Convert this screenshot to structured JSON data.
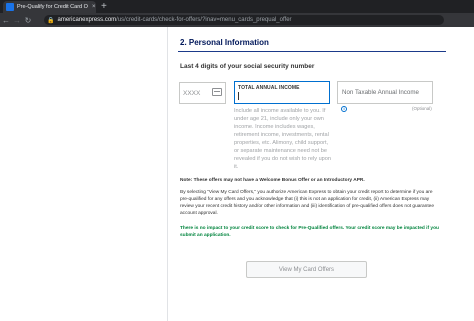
{
  "browser": {
    "tab_title": "Pre-Qualify for Credit Card O",
    "tab_close": "×",
    "new_tab": "+",
    "back": "←",
    "forward": "→",
    "reload": "↻",
    "url_host": "americanexpress.com",
    "url_path": "/us/credit-cards/check-for-offers/?inav=menu_cards_prequal_offer"
  },
  "form": {
    "section_title": "2. Personal Information",
    "ssn_label": "Last 4 digits of your social security number",
    "ssn_placeholder": "XXXX",
    "income_label": "TOTAL ANNUAL INCOME",
    "income_help": "Include all income available to you. If under age 21, include only your own income. Income includes wages, retirement income, investments, rental properties, etc. Alimony, child support, or separate maintenance need not be revealed if you do not wish to rely upon it.",
    "nontax_placeholder": "Non Taxable Annual Income",
    "info_glyph": "i",
    "optional_label": "(Optional)"
  },
  "disclosures": {
    "note": "Note: These offers may not have a Welcome Bonus Offer or an Introductory APR.",
    "consent": "By selecting \"View My Card Offers,\" you authorize American Express to obtain your credit report to determine if you are pre-qualified for any offers and you acknowledge that (i) this is not an application for credit, (ii) American Express may review your recent credit history and/or other information and (iii) identification of pre-qualified offers does not guarantee account approval.",
    "impact": "There is no impact to your credit score to check for Pre-Qualified offers. Your credit score may be impacted if you submit an application."
  },
  "submit_label": "View My Card Offers",
  "colors": {
    "brand_navy": "#00175a",
    "accent_blue": "#006fcf",
    "impact_green": "#00843d"
  }
}
